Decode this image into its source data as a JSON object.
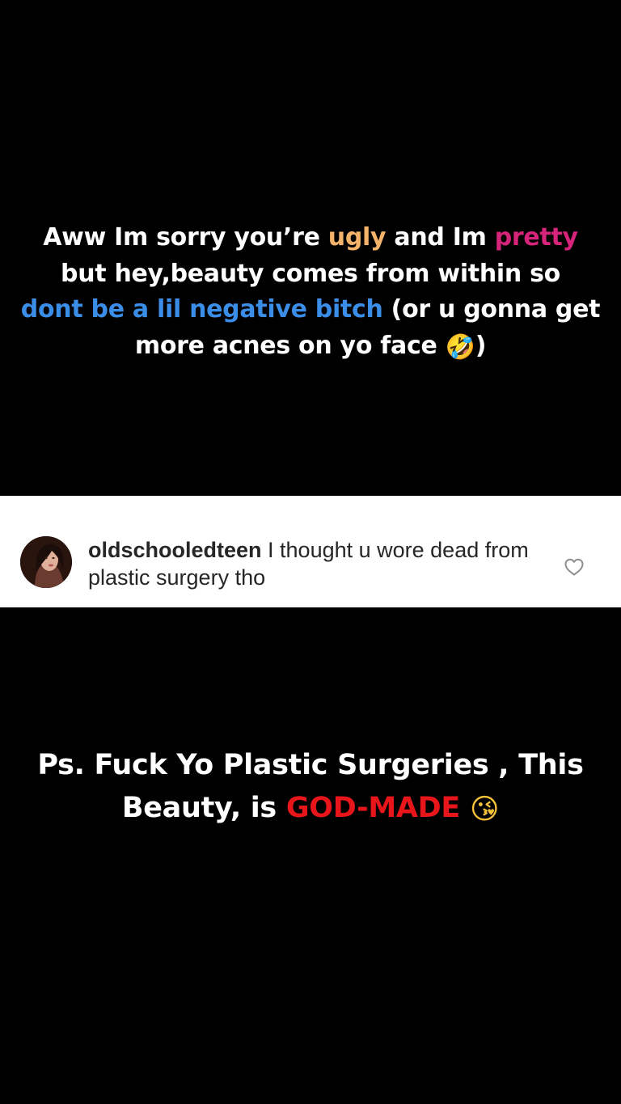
{
  "colors": {
    "background": "#000000",
    "text": "#ffffff",
    "orange": "#f3b36b",
    "pink": "#d6247a",
    "blue": "#3b8ee8",
    "red": "#e8161b"
  },
  "caption_top": {
    "part1": "Aww Im sorry you’re ",
    "highlight_ugly": "ugly",
    "part2": " and Im ",
    "highlight_pretty": "pretty",
    "part3": " but hey,beauty comes from within so ",
    "highlight_negative": "dont be a lil negative bitch",
    "part4": " (or u gonna get more acnes on yo face ",
    "emoji": "🤣",
    "emoji_icon": "rolling-on-floor-laughing-emoji",
    "part5": ")"
  },
  "comment": {
    "username": "oldschooledteen",
    "text": " I thought u wore dead from plastic surgery tho",
    "avatar_icon": "profile-photo-avatar",
    "like_icon": "heart-outline-icon"
  },
  "caption_bottom": {
    "part1": "Ps. Fuck Yo Plastic Surgeries , This Beauty, is ",
    "highlight_godmade": "GOD-MADE",
    "part2": " ",
    "emoji": "😘",
    "emoji_icon": "face-blowing-kiss-emoji"
  }
}
